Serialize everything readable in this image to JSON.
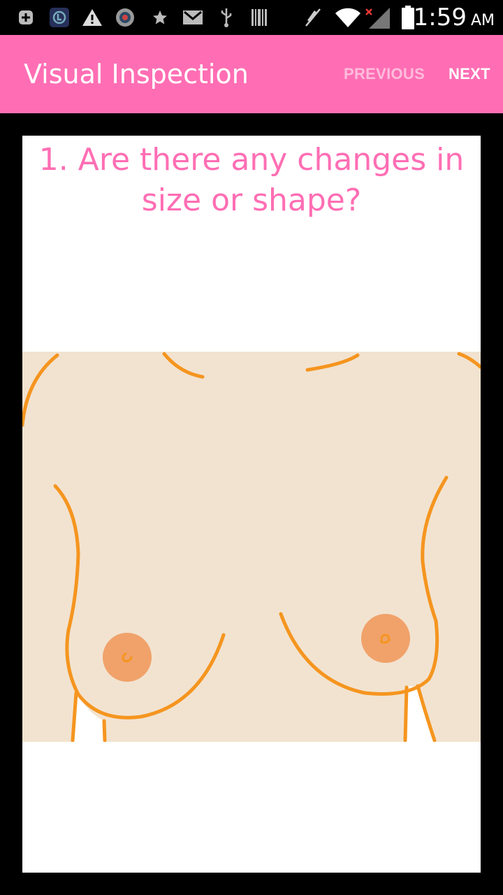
{
  "status_bar": {
    "time": "1:59",
    "ampm": "AM",
    "icons": [
      "add-notification-icon",
      "app-notification-icon",
      "warning-icon",
      "photo-app-icon",
      "star-icon",
      "gmail-icon",
      "usb-icon",
      "barcode-icon",
      "mute-icon",
      "wifi-icon",
      "signal-icon",
      "battery-icon"
    ]
  },
  "app_bar": {
    "title": "Visual Inspection",
    "previous_label": "PREVIOUS",
    "next_label": "NEXT"
  },
  "content": {
    "question": "1. Are there any changes in size or shape?",
    "illustration": "breast-illustration"
  },
  "colors": {
    "app_bar": "#ff6eb4",
    "question_text": "#ff6eb4",
    "skin": "#f2e3d0",
    "outline": "#f5951f",
    "areola": "#f0a26a"
  }
}
